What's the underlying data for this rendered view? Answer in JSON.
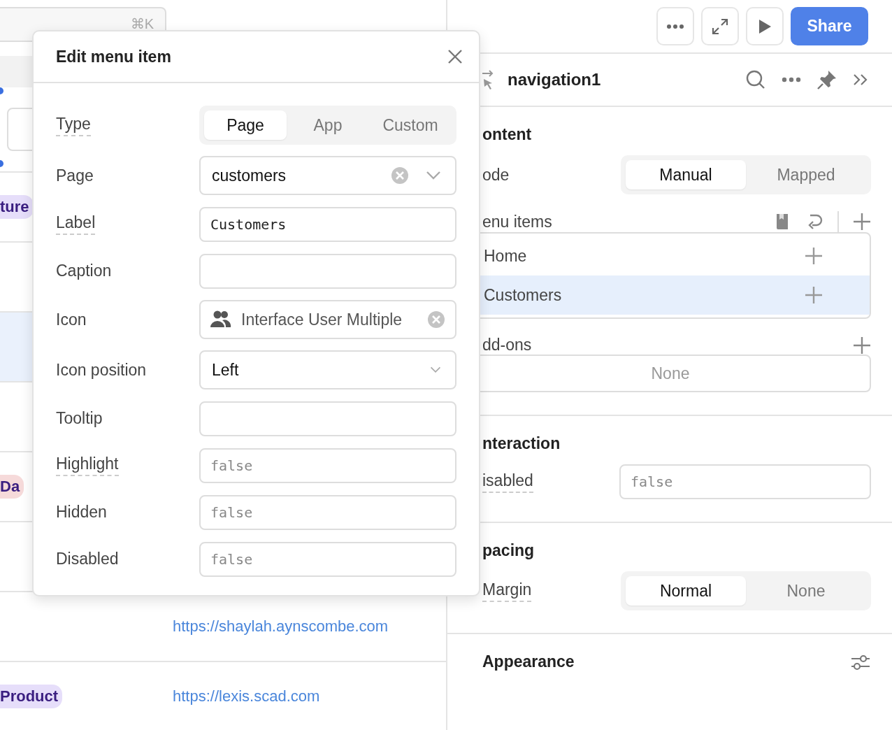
{
  "search": {
    "shortcut": "⌘K"
  },
  "rows": [
    {
      "selected": false,
      "tag": {
        "text": "ture",
        "color": "#e6defa"
      }
    },
    {
      "selected": false
    },
    {
      "selected": true
    },
    {
      "selected": false
    },
    {
      "selected": false,
      "tag": {
        "text": "Da",
        "color": "#f6dada"
      }
    },
    {
      "selected": false
    },
    {
      "selected": false,
      "link": "https://shaylah.aynscombe.com"
    },
    {
      "selected": false,
      "tag": {
        "text": "Product",
        "color": "#e6defa"
      },
      "link": "https://lexis.scad.com"
    }
  ],
  "topbar": {
    "share": "Share"
  },
  "inspector": {
    "title": "navigation1",
    "sections": [
      {
        "title": "ontent",
        "rows": [
          {
            "kind": "segmented",
            "label": "ode",
            "underlined": false,
            "options": [
              {
                "label": "Manual",
                "selected": true
              },
              {
                "label": "Mapped",
                "selected": false
              }
            ]
          },
          {
            "kind": "list",
            "label": "enu items",
            "underlined": false,
            "items": [
              {
                "label": "Home",
                "selected": false
              },
              {
                "label": "Customers",
                "selected": true
              }
            ]
          },
          {
            "kind": "addons",
            "label": "dd-ons",
            "underlined": false,
            "empty": "None"
          }
        ]
      },
      {
        "title": "nteraction",
        "rows": [
          {
            "kind": "code",
            "label": "isabled",
            "underlined": true,
            "placeholder": "false"
          }
        ]
      },
      {
        "title": "pacing",
        "rows": [
          {
            "kind": "segmented",
            "label": "Margin",
            "underlined": true,
            "options": [
              {
                "label": "Normal",
                "selected": true
              },
              {
                "label": "None",
                "selected": false
              }
            ]
          }
        ]
      },
      {
        "title": "Appearance",
        "settings": true
      }
    ]
  },
  "modal": {
    "title": "Edit menu item",
    "fields": [
      {
        "kind": "segmented",
        "label": "Type",
        "underlined": true,
        "options": [
          {
            "label": "Page",
            "selected": true
          },
          {
            "label": "App",
            "selected": false
          },
          {
            "label": "Custom",
            "selected": false
          }
        ]
      },
      {
        "kind": "select",
        "label": "Page",
        "underlined": false,
        "value": "customers",
        "clearable": true
      },
      {
        "kind": "code",
        "label": "Label",
        "underlined": true,
        "value": "Customers"
      },
      {
        "kind": "text",
        "label": "Caption",
        "underlined": false
      },
      {
        "kind": "icon-select",
        "label": "Icon",
        "underlined": false,
        "value": "Interface User Multiple",
        "clearable": true
      },
      {
        "kind": "select",
        "label": "Icon position",
        "underlined": false,
        "value": "Left",
        "clearable": false
      },
      {
        "kind": "text",
        "label": "Tooltip",
        "underlined": false
      },
      {
        "kind": "code",
        "label": "Highlight",
        "underlined": true,
        "placeholder": "false"
      },
      {
        "kind": "code",
        "label": "Hidden",
        "underlined": false,
        "placeholder": "false"
      },
      {
        "kind": "code",
        "label": "Disabled",
        "underlined": false,
        "placeholder": "false"
      }
    ]
  }
}
